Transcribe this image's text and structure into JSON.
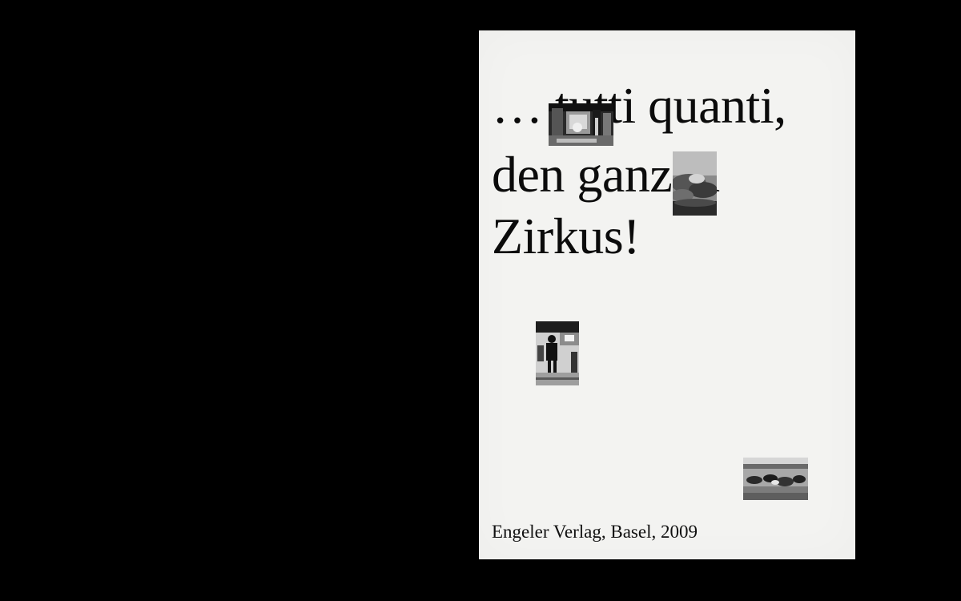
{
  "cover": {
    "title_lines": [
      "… tutti quanti,",
      "den ganzen",
      "Zirkus!"
    ],
    "publisher_line": "Engeler Verlag, Basel, 2009"
  },
  "colors": {
    "background": "#000000",
    "paper": "#f3f3f1",
    "ink": "#0b0b0b"
  }
}
